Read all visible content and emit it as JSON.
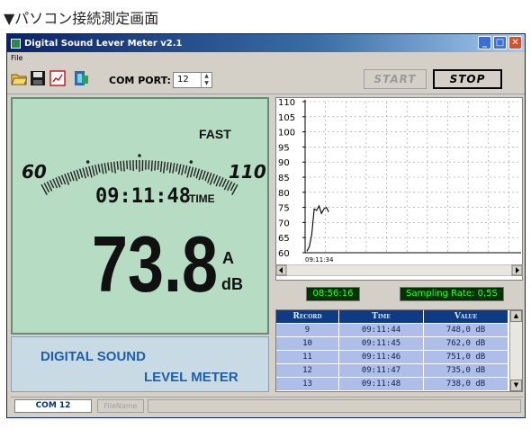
{
  "caption": "▼パソコン接続測定画面",
  "window": {
    "title": "Digital Sound Lever Meter v2.1",
    "controls": {
      "minimize": "_",
      "maximize": "□",
      "close": "✕"
    }
  },
  "menu": {
    "file": "File"
  },
  "toolbar": {
    "icons": [
      "open-folder-icon",
      "save-disk-icon",
      "chart-icon",
      "exit-icon"
    ],
    "com_port_label": "COM PORT:",
    "com_port_value": "12",
    "start_label": "START",
    "stop_label": "STOP"
  },
  "lcd": {
    "scale_min": "60",
    "scale_max": "110",
    "mode": "FAST",
    "time": "09:11:48",
    "time_label": "TIME",
    "reading": "73.8",
    "weighting": "A",
    "unit": "dB"
  },
  "brand": {
    "line1": "DIGITAL SOUND",
    "line2": "LEVEL METER"
  },
  "chart_data": {
    "type": "line",
    "y_ticks": [
      "110",
      "105",
      "100",
      "95",
      "90",
      "85",
      "80",
      "75",
      "70",
      "65",
      "60"
    ],
    "ylim": [
      60,
      110
    ],
    "x_label_start": "09:11:34",
    "grid": true,
    "series": [
      {
        "values": [
          60.5,
          62,
          66,
          74.5,
          74,
          75.5,
          73,
          74.5,
          75,
          73.5
        ]
      }
    ]
  },
  "clock": "08:56:16",
  "sampling_rate": "Sampling Rate: 0,5S",
  "table": {
    "headers": [
      "Record",
      "Time",
      "Value"
    ],
    "rows": [
      [
        "9",
        "09:11:44",
        "748,0 dB"
      ],
      [
        "10",
        "09:11:45",
        "762,0 dB"
      ],
      [
        "11",
        "09:11:46",
        "751,0 dB"
      ],
      [
        "12",
        "09:11:47",
        "735,0 dB"
      ],
      [
        "13",
        "09:11:48",
        "738,0 dB"
      ]
    ]
  },
  "status": {
    "com": "COM 12",
    "file": "FileName"
  },
  "colors": {
    "lcd_bg": "#b6dcc3",
    "table_header": "#0e3a86",
    "table_row": "#aebee8",
    "led_green": "#33ff33",
    "brand_text": "#1f5ea8"
  }
}
